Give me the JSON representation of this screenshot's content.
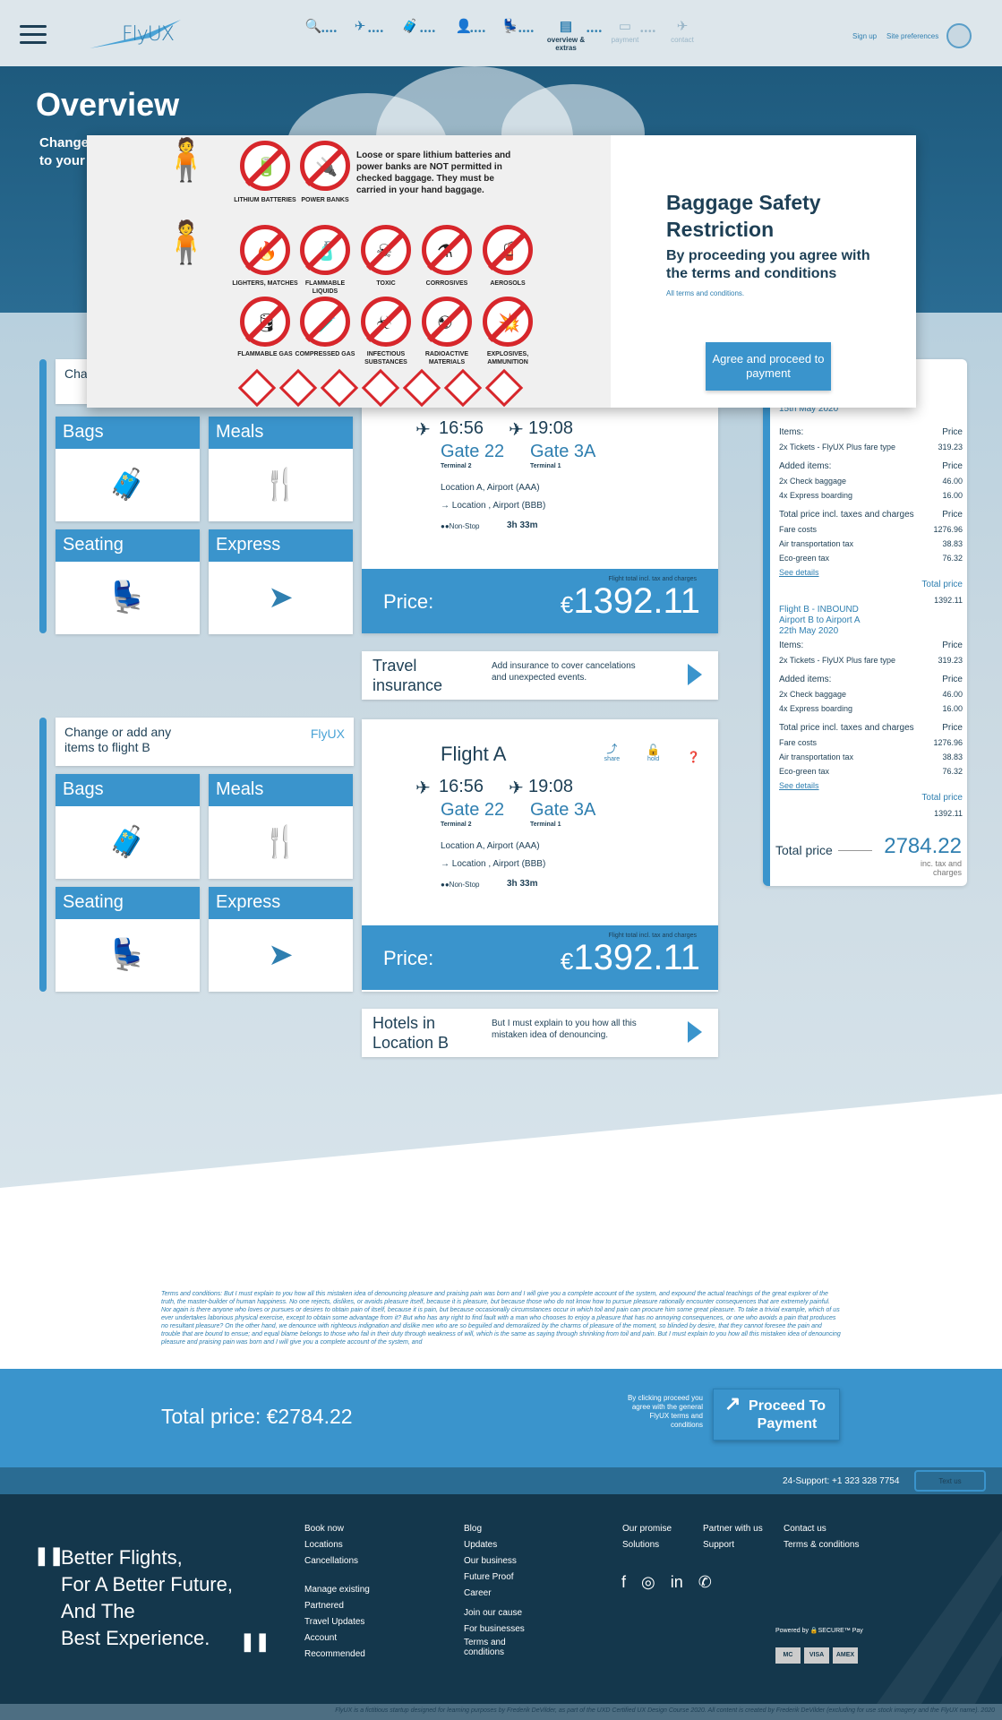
{
  "header": {
    "logo": "FlyUX",
    "steps": [
      {
        "icon": "search-icon",
        "label": ""
      },
      {
        "icon": "plane-icon",
        "label": ""
      },
      {
        "icon": "suitcase-icon",
        "label": ""
      },
      {
        "icon": "person-icon",
        "label": ""
      },
      {
        "icon": "seat-icon",
        "label": ""
      },
      {
        "icon": "overview-icon",
        "label": "overview & extras"
      },
      {
        "icon": "card-icon",
        "label": "payment"
      },
      {
        "icon": "takeoff-icon",
        "label": "contact"
      }
    ],
    "sign_up": "Sign up",
    "site_preferences": "Site preferences"
  },
  "hero": {
    "title": "Overview",
    "subtitle_line1": "Change",
    "subtitle_line2": "to your"
  },
  "modal": {
    "note": "Loose or spare lithium batteries and power banks are NOT permitted in checked baggage. They must be carried in your hand baggage.",
    "items_row1": [
      "LITHIUM BATTERIES",
      "POWER BANKS"
    ],
    "items_row2": [
      "LIGHTERS, MATCHES",
      "FLAMMABLE LIQUIDS",
      "TOXIC",
      "CORROSIVES",
      "AEROSOLS"
    ],
    "items_row3": [
      "FLAMMABLE GAS",
      "COMPRESSED GAS",
      "INFECTIOUS SUBSTANCES",
      "RADIOACTIVE MATERIALS",
      "EXPLOSIVES, AMMUNITION"
    ],
    "title": "Baggage Safety Restriction",
    "subtitle": "By proceeding you agree with the terms and conditions",
    "link": "All terms and conditions.",
    "agree_button": "Agree and proceed to payment"
  },
  "flight_a_group": {
    "change_text": "Cha item",
    "tiles": [
      "Bags",
      "Meals",
      "Seating",
      "Express"
    ],
    "dep_time": "16:56",
    "arr_time": "19:08",
    "dep_gate": "Gate 22",
    "arr_gate": "Gate 3A",
    "dep_terminal": "Terminal 2",
    "arr_terminal": "Terminal 1",
    "from": "Location A, Airport (AAA)",
    "to": "→ Location , Airport (BBB)",
    "stops": "●●Non-Stop",
    "duration": "3h 33m",
    "price_note": "Flight total incl. tax and charges",
    "price_label": "Price:",
    "price_currency": "€",
    "price_value": "1392.11",
    "extra_title": "Travel insurance",
    "extra_desc": "Add insurance to cover cancelations and unexpected events."
  },
  "flight_b_group": {
    "change_text": "Change or add any items to flight B",
    "tiles": [
      "Bags",
      "Meals",
      "Seating",
      "Express"
    ],
    "title": "Flight A",
    "share": "share",
    "hold": "hold",
    "dep_time": "16:56",
    "arr_time": "19:08",
    "dep_gate": "Gate 22",
    "arr_gate": "Gate 3A",
    "dep_terminal": "Terminal 2",
    "arr_terminal": "Terminal 1",
    "from": "Location A, Airport (AAA)",
    "to": "→ Location , Airport (BBB)",
    "stops": "●●Non-Stop",
    "duration": "3h 33m",
    "price_note": "Flight total incl. tax and charges",
    "price_label": "Price:",
    "price_currency": "€",
    "price_value": "1392.11",
    "extra_title": "Hotels in Location B",
    "extra_desc": "But I must explain to you how all this mistaken idea of denouncing."
  },
  "summary": {
    "a_date": "15th May 2020",
    "items": "Items:",
    "price": "Price",
    "tickets": "2x Tickets - FlyUX Plus fare type",
    "tickets_price": "319.23",
    "added_items": "Added items:",
    "check_baggage": "2x Check baggage",
    "check_baggage_price": "46.00",
    "express": "4x Express boarding",
    "express_price": "16.00",
    "total_incl": "Total price incl. taxes and charges",
    "fare": "Fare costs",
    "fare_price": "1276.96",
    "air_tax": "Air transportation tax",
    "air_tax_price": "38.83",
    "eco_tax": "Eco-green tax",
    "eco_tax_price": "76.32",
    "see_details": "See details",
    "total_price": "Total price",
    "flight_total": "1392.11",
    "b_title1": "Flight B - INBOUND",
    "b_title2": "Airport B to Airport A",
    "b_date": "22th May 2020",
    "total_label": "Total price",
    "total_value": "2784.22",
    "total_note": "inc. tax and charges"
  },
  "terms": {
    "text": "Terms and conditions: But I must explain to you how all this mistaken idea of denouncing pleasure and praising pain was born and I will give you a complete account of the system, and expound the actual teachings of the great explorer of the truth, the master-builder of human happiness. No one rejects, dislikes, or avoids pleasure itself, because it is pleasure, but because those who do not know how to pursue pleasure rationally encounter consequences that are extremely painful. Nor again is there anyone who loves or pursues or desires to obtain pain of itself, because it is pain, but because occasionally circumstances occur in which toil and pain can procure him some great pleasure. To take a trivial example, which of us ever undertakes laborious physical exercise, except to obtain some advantage from it? But who has any right to find fault with a man who chooses to enjoy a pleasure that has no annoying consequences, or one who avoids a pain that produces no resultant pleasure? On the other hand, we denounce with righteous indignation and dislike men who are so beguiled and demoralized by the charms of pleasure of the moment, so blinded by desire, that they cannot foresee the pain and trouble that are bound to ensue; and equal blame belongs to those who fail in their duty through weakness of will, which is the same as saying through shrinking from toil and pain. But I must explain to you how all this mistaken idea of denouncing pleasure and praising pain was born and I will give you a complete account of the system, and"
  },
  "totalbar": {
    "total": "Total price: €2784.22",
    "note": "By clicking proceed you agree with the general FlyUX terms and conditions",
    "proceed": "Proceed To Payment"
  },
  "support": {
    "phone": "24-Support: +1 323 328 7754",
    "button": "Text us"
  },
  "footer": {
    "slogan": [
      "Better Flights,",
      "For A Better Future,",
      "And The",
      "Best Experience."
    ],
    "col1a": [
      "Book now",
      "Locations",
      "Cancellations"
    ],
    "col1b": [
      "Manage existing",
      "Partnered",
      "Travel Updates",
      "Account",
      "Recommended"
    ],
    "col2a": [
      "Blog",
      "Updates",
      "Our business",
      "Future Proof",
      "Career"
    ],
    "col2b": [
      "Join our cause",
      "For businesses",
      "Terms and conditions"
    ],
    "col3": [
      "Our promise",
      "Solutions"
    ],
    "col4": [
      "Partner with us",
      "Support"
    ],
    "col5": [
      "Contact us",
      "Terms & conditions"
    ],
    "powered": "Powered by 🔒SECURE™ Pay",
    "cards": [
      "MC",
      "VISA",
      "AMEX"
    ]
  },
  "copyright": "FlyUX is a fictitious startup designed for learning purposes by Frederik DeVilder, as part of the UXD Certified UX Design Course 2020. All content is created by Frederik DeVilder (excluding for use stock imagery and the FlyUX name). 2020"
}
